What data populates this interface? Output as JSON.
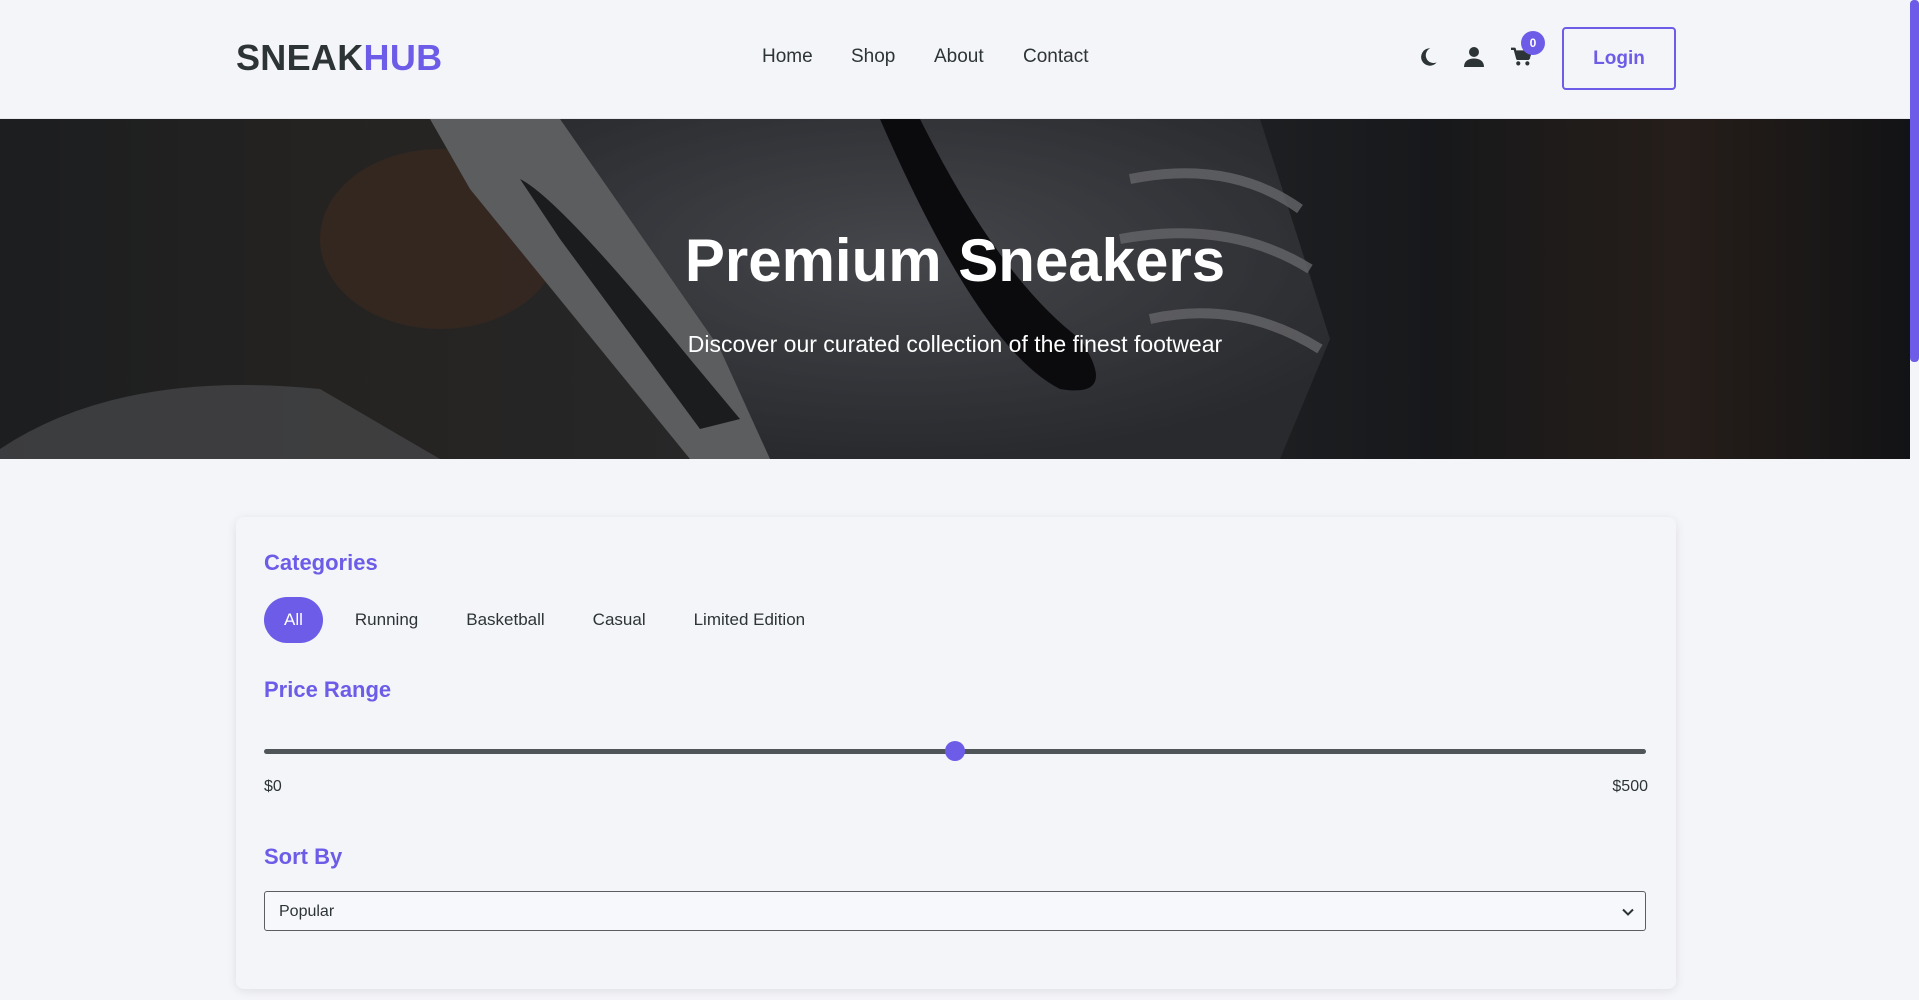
{
  "brand": {
    "part1": "SNEAK",
    "part2": "HUB"
  },
  "nav": {
    "items": [
      "Home",
      "Shop",
      "About",
      "Contact"
    ]
  },
  "header_icons": [
    "moon-icon",
    "user-icon",
    "cart-icon"
  ],
  "cart": {
    "count": "0"
  },
  "login": {
    "label": "Login"
  },
  "hero": {
    "title": "Premium Sneakers",
    "subtitle": "Discover our curated collection of the finest footwear"
  },
  "filters": {
    "categories_title": "Categories",
    "categories": [
      "All",
      "Running",
      "Basketball",
      "Casual",
      "Limited Edition"
    ],
    "active_category": "All",
    "price_title": "Price Range",
    "price_min_label": "$0",
    "price_max_label": "$500",
    "price_value_fraction": 0.5,
    "sort_title": "Sort By",
    "sort_value": "Popular"
  },
  "colors": {
    "accent": "#6c5ce7",
    "text": "#2d3436",
    "background": "#f4f5f9"
  }
}
